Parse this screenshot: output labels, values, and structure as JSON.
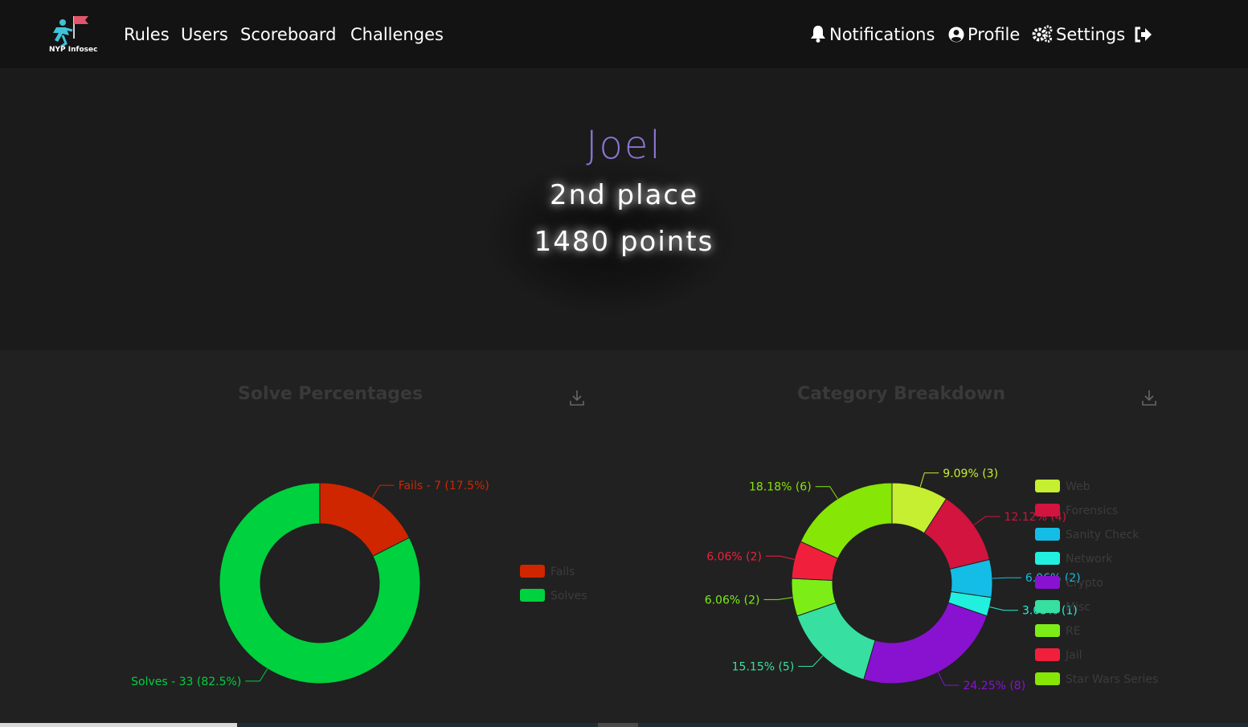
{
  "brand": {
    "logo_text": "NYP Infosec"
  },
  "nav": {
    "left": [
      "Rules",
      "Users",
      "Scoreboard",
      "Challenges"
    ],
    "notifications": "Notifications",
    "profile": "Profile",
    "settings": "Settings"
  },
  "user": {
    "name": "Joel",
    "place": "2nd place",
    "points": "1480 points"
  },
  "charts": {
    "solve_title": "Solve Percentages",
    "category_title": "Category Breakdown"
  },
  "chart_data": [
    {
      "type": "pie",
      "title": "Solve Percentages",
      "categories": [
        "Fails",
        "Solves"
      ],
      "values": [
        7,
        33
      ],
      "percents": [
        "17.5%",
        "82.5%"
      ],
      "labels": [
        "Fails - 7 (17.5%)",
        "Solves - 33 (82.5%)"
      ],
      "colors": [
        "#cf2600",
        "#00d13f"
      ],
      "donut": true,
      "legend": "right"
    },
    {
      "type": "pie",
      "title": "Category Breakdown",
      "categories": [
        "Web",
        "Forensics",
        "Sanity Check",
        "Network",
        "Crypto",
        "Misc",
        "RE",
        "Jail",
        "Star Wars Series"
      ],
      "values": [
        3,
        4,
        2,
        1,
        8,
        5,
        2,
        2,
        6
      ],
      "colors": [
        "#c5ef30",
        "#d2143f",
        "#14bde5",
        "#21f0de",
        "#8812d0",
        "#37e0a0",
        "#7ded17",
        "#f0203d",
        "#86e605"
      ],
      "labels": [
        "9.09% (3)",
        "12.12% (4)",
        "6.06% (2)",
        "3.03% (1)",
        "24.25% (8)",
        "15.15% (5)",
        "6.06% (2)",
        "6.06% (2)",
        "18.18% (6)"
      ],
      "donut": true,
      "legend": "right"
    }
  ]
}
